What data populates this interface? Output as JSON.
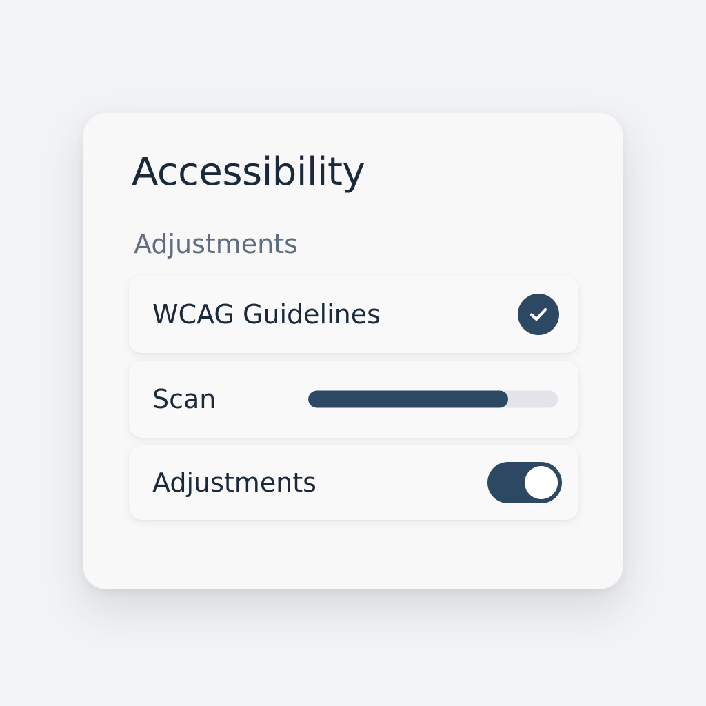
{
  "panel": {
    "title": "Accessibility",
    "section_label": "Adjustments"
  },
  "rows": {
    "wcag": {
      "label": "WCAG Guidelines",
      "checked": true,
      "icon": "check-icon"
    },
    "scan": {
      "label": "Scan",
      "progress_percent": 80
    },
    "adjustments": {
      "label": "Adjustments",
      "toggle_on": true
    }
  },
  "colors": {
    "accent": "#2d4863",
    "title_text": "#1b2a3b",
    "section_text": "#5e6e80",
    "track": "#e2e4e7",
    "background": "#f2f3f5",
    "card": "#f8f8f8"
  }
}
